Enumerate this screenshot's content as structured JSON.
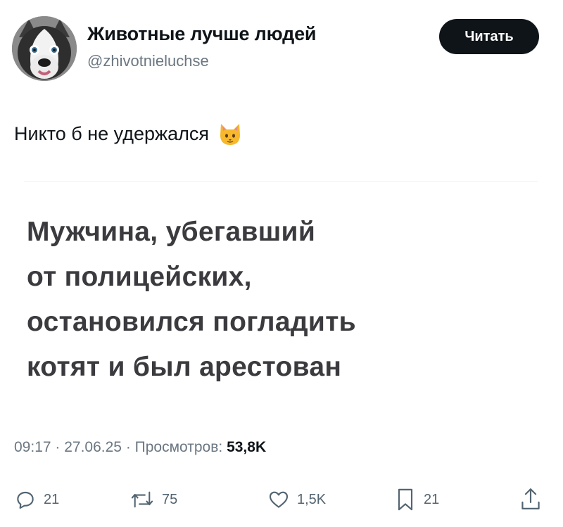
{
  "author": {
    "display_name": "Животные лучше людей",
    "handle": "@zhivotnieluchse",
    "avatar_icon": "husky-dog-avatar"
  },
  "follow_button": {
    "label": "Читать"
  },
  "tweet": {
    "text": "Никто б не удержался",
    "emoji_icon": "cat-face-icon"
  },
  "media": {
    "headline_lines": [
      "Мужчина, убегавший",
      "от полицейских,",
      "остановился погладить",
      "котят и был арестован"
    ]
  },
  "meta": {
    "time": "09:17",
    "separator": " · ",
    "date": "27.06.25",
    "views_label": "Просмотров:",
    "views_count": "53,8K"
  },
  "actions": {
    "replies": "21",
    "reposts": "75",
    "likes": "1,5K",
    "bookmarks": "21"
  },
  "colors": {
    "text_primary": "#0f1419",
    "text_secondary": "#6b7782",
    "button_bg": "#0f1419",
    "headline": "#3b3b3f"
  }
}
